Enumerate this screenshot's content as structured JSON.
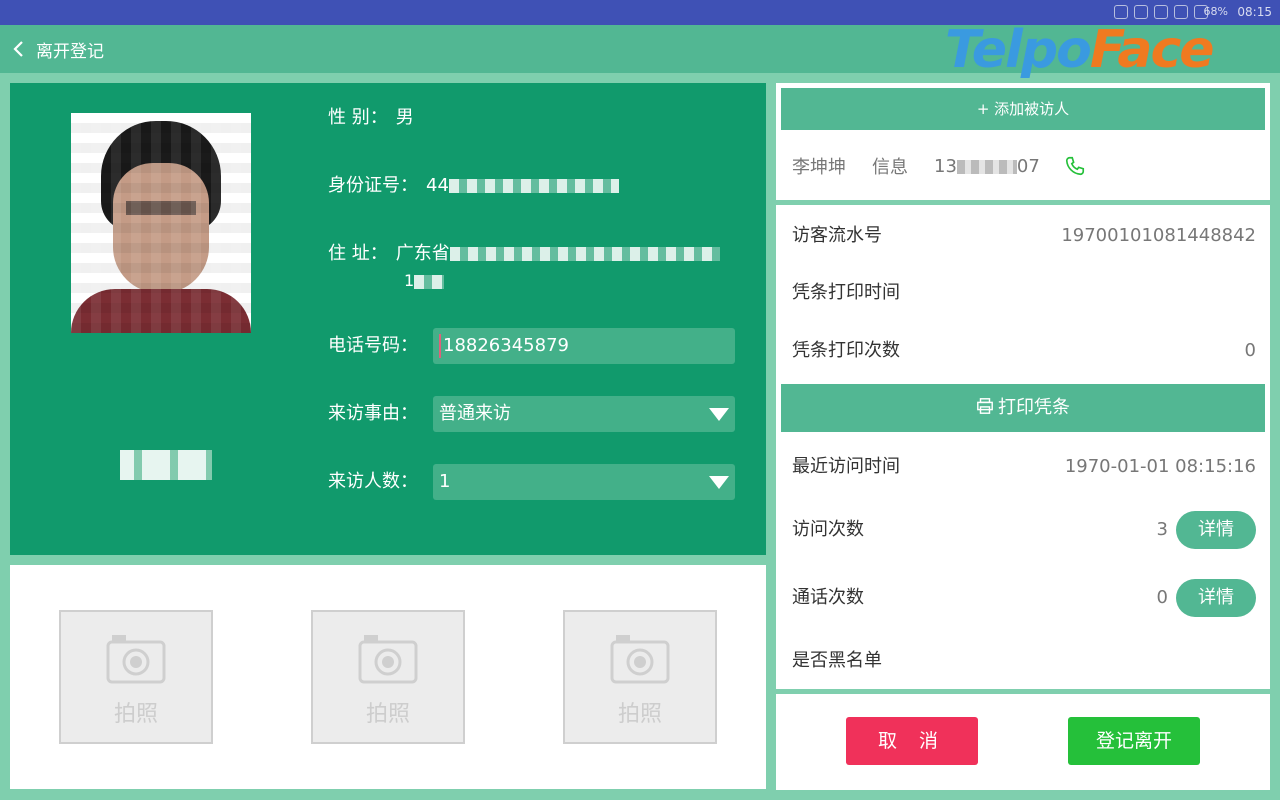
{
  "status_bar": {
    "battery": "68%",
    "time": "08:15"
  },
  "header": {
    "title": "离开登记",
    "logo_part1": "Telpo",
    "logo_part2": "Face"
  },
  "visitor": {
    "gender_label": "性 别：",
    "gender": "男",
    "id_label": "身份证号：",
    "id_prefix": "44",
    "address_label": "住 址：",
    "address_prefix": "广东省",
    "address_line2": "1",
    "phone_label": "电话号码：",
    "phone": "18826345879",
    "reason_label": "来访事由：",
    "reason": "普通来访",
    "count_label": "来访人数：",
    "count": "1"
  },
  "photos": {
    "caption": "拍照"
  },
  "visitee": {
    "add_button": "+ 添加被访人",
    "name": "李坤坤",
    "info_label": "信息",
    "phone_prefix": "13",
    "phone_suffix": "07"
  },
  "record": {
    "serial_label": "访客流水号",
    "serial": "19700101081448842",
    "print_time_label": "凭条打印时间",
    "print_count_label": "凭条打印次数",
    "print_count": "0",
    "print_button": "打印凭条",
    "last_visit_label": "最近访问时间",
    "last_visit": "1970-01-01 08:15:16",
    "visit_count_label": "访问次数",
    "visit_count": "3",
    "call_count_label": "通话次数",
    "call_count": "0",
    "detail_button": "详情",
    "blacklist_label": "是否黑名单"
  },
  "actions": {
    "cancel": "取 消",
    "leave": "登记离开"
  },
  "colors": {
    "accent": "#52b793",
    "panel": "#119a6c",
    "cancel": "#f0315a",
    "confirm": "#25c03a"
  }
}
